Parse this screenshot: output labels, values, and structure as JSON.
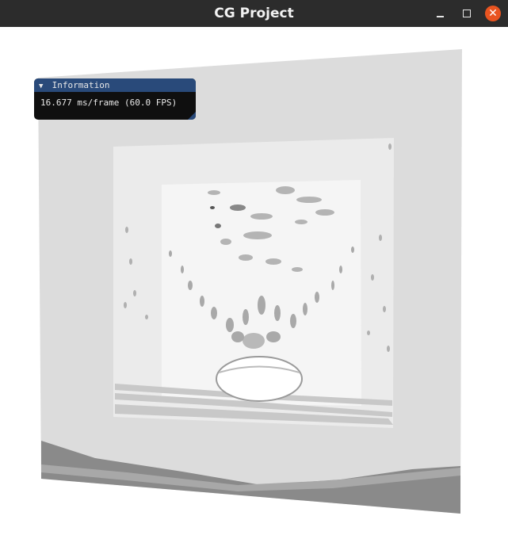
{
  "window": {
    "title": "CG Project",
    "controls": {
      "minimize": "minimize",
      "maximize": "maximize",
      "close": "✕"
    },
    "close_color": "#e95420",
    "titlebar_color": "#2c2c2c"
  },
  "imgui_window": {
    "title": "Information",
    "collapse_arrow": "▼",
    "fps_text": "16.677 ms/frame (60.0 FPS)",
    "header_color": "#294a7a"
  },
  "scene": {
    "description_icon": "3d-render-viewport"
  }
}
